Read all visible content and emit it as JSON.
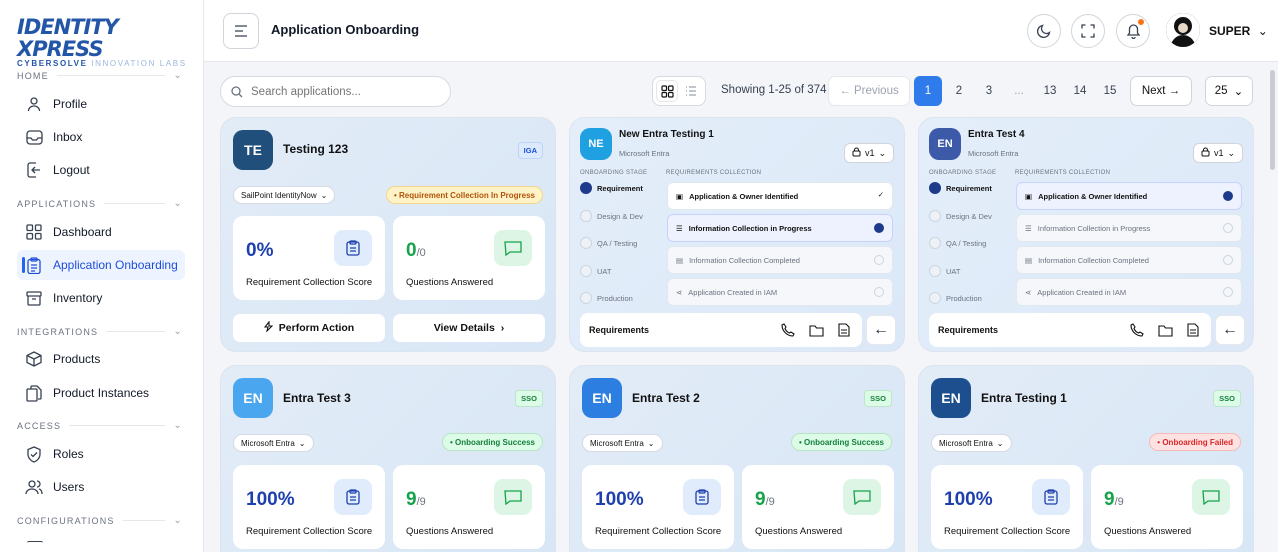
{
  "brand": {
    "name": "IDENTITY XPRESS",
    "sub1": "CYBERSOLVE",
    "sub2": " INNOVATION LABS"
  },
  "sidebar": {
    "sections": [
      {
        "label": "HOME"
      },
      {
        "label": "APPLICATIONS"
      },
      {
        "label": "INTEGRATIONS"
      },
      {
        "label": "ACCESS"
      },
      {
        "label": "CONFIGURATIONS"
      }
    ],
    "items": [
      {
        "label": "Profile"
      },
      {
        "label": "Inbox"
      },
      {
        "label": "Logout"
      },
      {
        "label": "Dashboard"
      },
      {
        "label": "Application Onboarding",
        "active": true
      },
      {
        "label": "Inventory"
      },
      {
        "label": "Products"
      },
      {
        "label": "Product Instances"
      },
      {
        "label": "Roles"
      },
      {
        "label": "Users"
      }
    ]
  },
  "header": {
    "title": "Application Onboarding",
    "user": "SUPER"
  },
  "toolbar": {
    "search_placeholder": "Search applications...",
    "showing": "Showing 1-25 of 374",
    "prev": "Previous",
    "next": "Next",
    "pages": [
      "1",
      "2",
      "3",
      "...",
      "13",
      "14",
      "15"
    ],
    "current_page": "1",
    "page_size": "25"
  },
  "cards": [
    {
      "initials": "TE",
      "name": "Testing 123",
      "tag": "IGA",
      "vendor": "SailPoint IdentityNow",
      "status": "Requirement Collection In Progress",
      "score": "0%",
      "score_label": "Requirement Collection Score",
      "answered": "0",
      "answered_total": "/0",
      "answered_label": "Questions Answered",
      "action1": "Perform Action",
      "action2": "View Details",
      "badge_color": "#1f4f7a"
    },
    {
      "initials": "NE",
      "name": "New Entra Testing 1",
      "vendor": "Microsoft Entra",
      "version": "v1",
      "badge_color": "#1fa0e0"
    },
    {
      "initials": "EN",
      "name": "Entra Test 4",
      "vendor": "Microsoft Entra",
      "version": "v1",
      "badge_color": "#3c5aa8"
    },
    {
      "initials": "EN",
      "name": "Entra Test 3",
      "tag": "SSO",
      "vendor": "Microsoft Entra",
      "status": "Onboarding Success",
      "score": "100%",
      "score_label": "Requirement Collection Score",
      "answered": "9",
      "answered_total": "/9",
      "answered_label": "Questions Answered",
      "badge_color": "#4aa6ee"
    },
    {
      "initials": "EN",
      "name": "Entra Test 2",
      "tag": "SSO",
      "vendor": "Microsoft Entra",
      "status": "Onboarding Success",
      "score": "100%",
      "score_label": "Requirement Collection Score",
      "answered": "9",
      "answered_total": "/9",
      "answered_label": "Questions Answered",
      "badge_color": "#2c7fe0"
    },
    {
      "initials": "EN",
      "name": "Entra Testing 1",
      "tag": "SSO",
      "vendor": "Microsoft Entra",
      "status": "Onboarding Failed",
      "score": "100%",
      "score_label": "Requirement Collection Score",
      "answered": "9",
      "answered_total": "/9",
      "answered_label": "Questions Answered",
      "badge_color": "#1d4f8f"
    }
  ],
  "workflow": {
    "stage_header": "ONBOARDING STAGE",
    "req_header": "REQUIREMENTS COLLECTION",
    "stages": [
      "Requirement",
      "Design & Dev",
      "QA / Testing",
      "UAT",
      "Production"
    ],
    "requirements": [
      "Application & Owner Identified",
      "Information Collection in Progress",
      "Information Collection Completed",
      "Application Created in IAM"
    ],
    "footer": "Requirements"
  }
}
